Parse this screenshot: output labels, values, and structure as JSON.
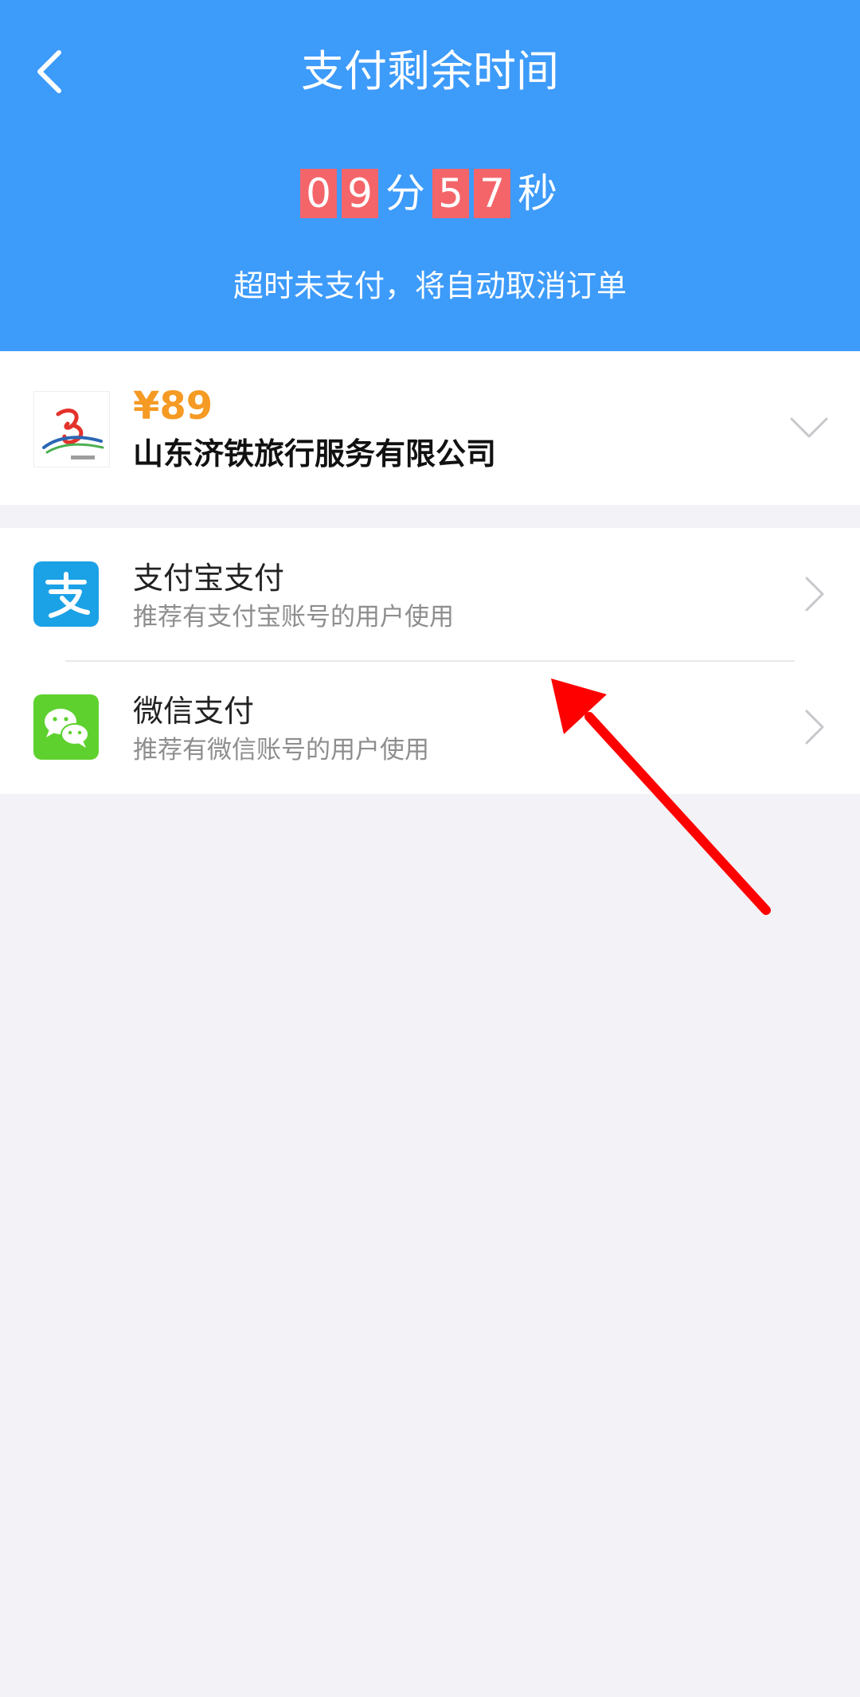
{
  "header": {
    "title": "支付剩余时间",
    "countdown": {
      "minutes_digits": [
        "0",
        "9"
      ],
      "minutes_unit": "分",
      "seconds_digits": [
        "5",
        "7"
      ],
      "seconds_unit": "秒"
    },
    "notice": "超时未支付，将自动取消订单"
  },
  "order": {
    "price": "¥89",
    "merchant": "山东济铁旅行服务有限公司"
  },
  "payment_methods": [
    {
      "name": "支付宝支付",
      "description": "推荐有支付宝账号的用户使用",
      "icon": "alipay-icon"
    },
    {
      "name": "微信支付",
      "description": "推荐有微信账号的用户使用",
      "icon": "wechat-icon"
    }
  ],
  "colors": {
    "header_bg": "#3d9bfa",
    "countdown_digit_bg": "#f4656a",
    "price": "#f59a23",
    "alipay": "#1ba1e6",
    "wechat": "#5ed12e",
    "annotation": "#ff0000"
  }
}
